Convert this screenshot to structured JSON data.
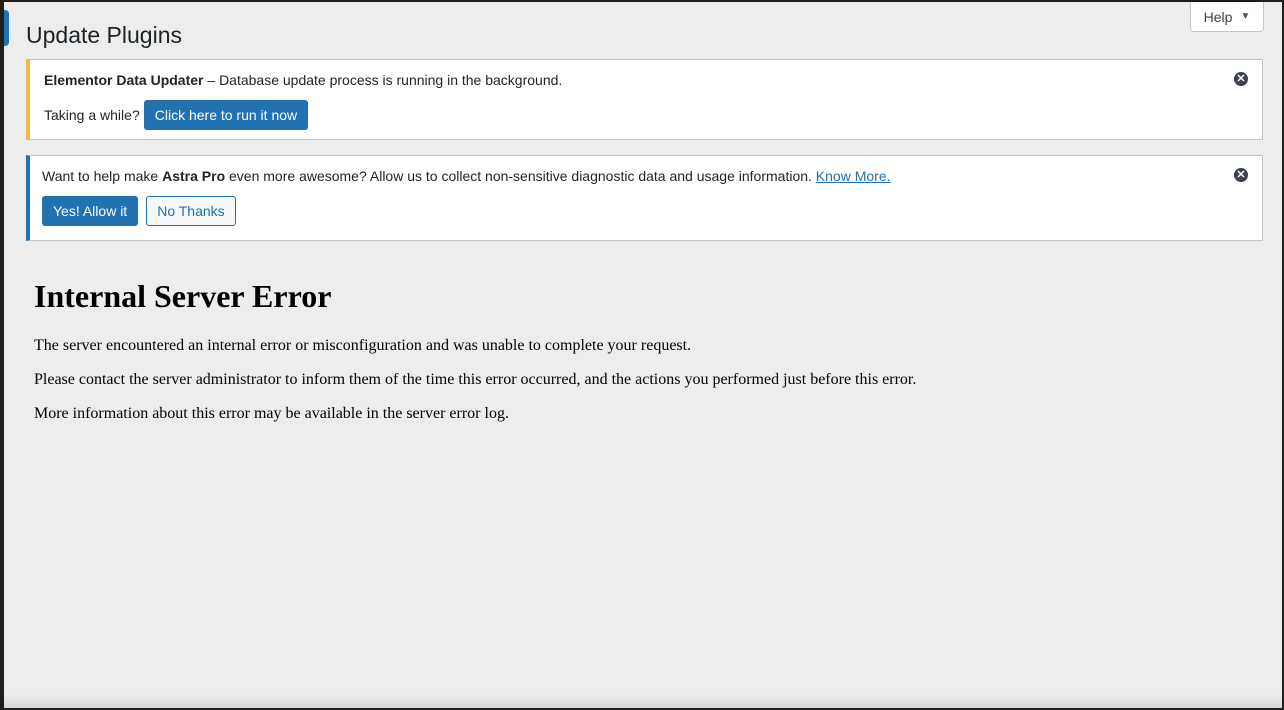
{
  "header": {
    "title": "Update Plugins",
    "help_label": "Help",
    "help_caret": "▼"
  },
  "notices": {
    "elementor": {
      "title": "Elementor Data Updater",
      "separator": " – ",
      "message": "Database update process is running in the background.",
      "prompt": "Taking a while?",
      "button_label": "Click here to run it now",
      "dismiss_glyph": "✕"
    },
    "astra": {
      "text_before": "Want to help make ",
      "brand": "Astra Pro",
      "text_after": " even more awesome? Allow us to collect non-sensitive diagnostic data and usage information. ",
      "link_label": "Know More.",
      "allow_label": "Yes! Allow it",
      "decline_label": "No Thanks",
      "dismiss_glyph": "✕"
    }
  },
  "error": {
    "heading": "Internal Server Error",
    "paragraphs": [
      "The server encountered an internal error or misconfiguration and was unable to complete your request.",
      "Please contact the server administrator to inform them of the time this error occurred, and the actions you performed just before this error.",
      "More information about this error may be available in the server error log."
    ]
  },
  "colors": {
    "wp_blue": "#2271b1",
    "elementor_accent": "#f0b849",
    "background": "#ededed"
  },
  "icons": {
    "dismiss": "close-circle-icon",
    "help_caret": "caret-down-icon"
  }
}
